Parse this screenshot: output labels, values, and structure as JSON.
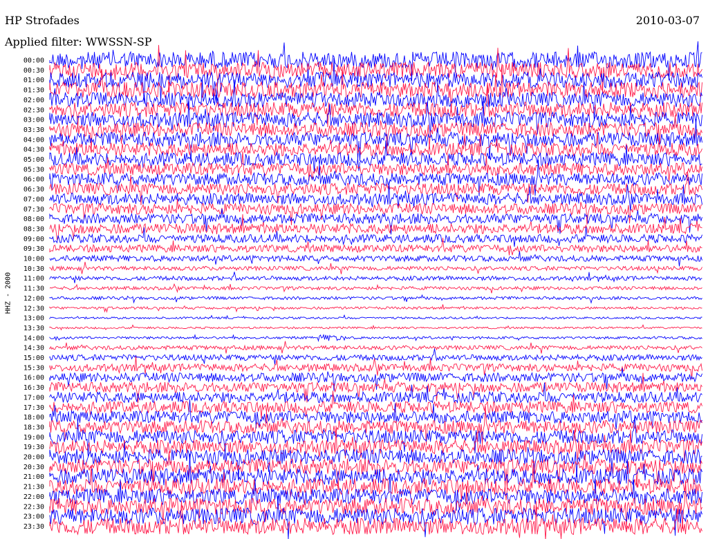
{
  "header": {
    "station": "HP Strofades",
    "date": "2010-03-07",
    "filter": "Applied filter: WWSSN-SP"
  },
  "chart_data": {
    "type": "line",
    "subtype": "helicorder",
    "title": "HP Strofades",
    "subtitle": "Applied filter: WWSSN-SP",
    "date": "2010-03-07",
    "ylabel": "HHZ - 2000",
    "row_interval_minutes": 30,
    "tick_labels": [
      "00:00",
      "00:30",
      "01:00",
      "01:30",
      "02:00",
      "02:30",
      "03:00",
      "03:30",
      "04:00",
      "04:30",
      "05:00",
      "05:30",
      "06:00",
      "06:30",
      "07:00",
      "07:30",
      "08:00",
      "08:30",
      "09:00",
      "09:30",
      "10:00",
      "10:30",
      "11:00",
      "11:30",
      "12:00",
      "12:30",
      "13:00",
      "13:30",
      "14:00",
      "14:30",
      "15:00",
      "15:30",
      "16:00",
      "16:30",
      "17:00",
      "17:30",
      "18:00",
      "18:30",
      "19:00",
      "19:30",
      "20:00",
      "20:30",
      "21:00",
      "21:30",
      "22:00",
      "22:30",
      "23:00",
      "23:30"
    ],
    "series_colors": [
      "#0000ff",
      "#ff1a4a"
    ],
    "relative_noise_amplitude": [
      1.0,
      0.95,
      0.95,
      0.95,
      0.9,
      0.9,
      0.9,
      0.85,
      0.85,
      0.8,
      0.8,
      0.75,
      0.75,
      0.7,
      0.7,
      0.65,
      0.6,
      0.6,
      0.5,
      0.45,
      0.35,
      0.25,
      0.25,
      0.2,
      0.18,
      0.15,
      0.12,
      0.12,
      0.15,
      0.25,
      0.35,
      0.45,
      0.55,
      0.6,
      0.65,
      0.7,
      0.75,
      0.8,
      0.85,
      0.85,
      0.9,
      0.9,
      0.95,
      0.95,
      0.95,
      1.0,
      1.0,
      1.0
    ],
    "grid": false,
    "legend": "none"
  }
}
